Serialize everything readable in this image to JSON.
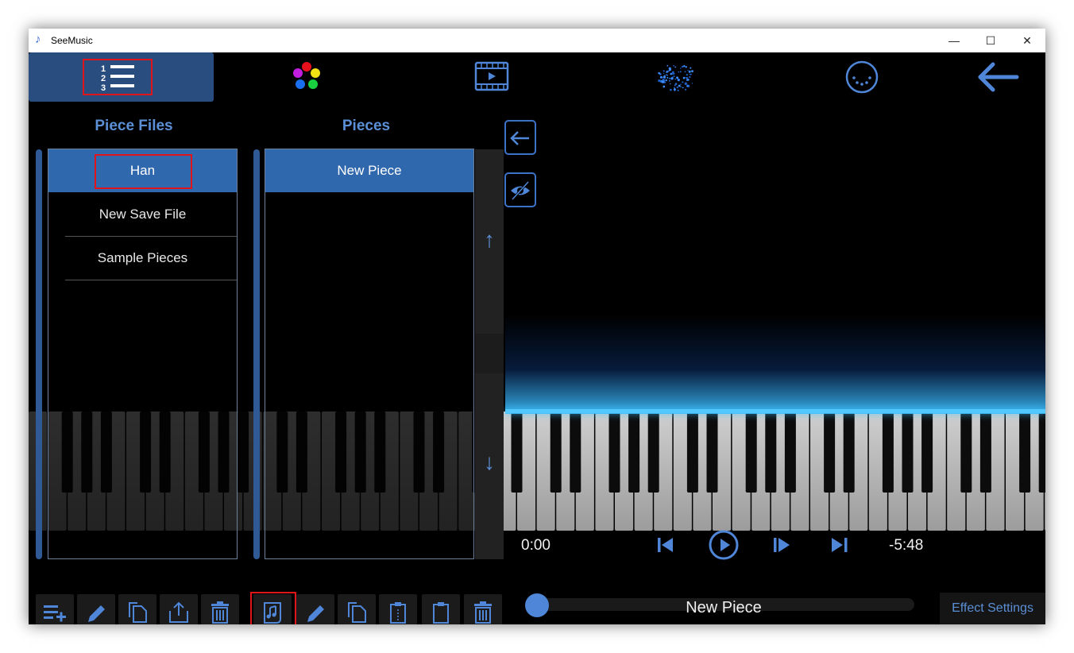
{
  "window": {
    "title": "SeeMusic",
    "min_symbol": "—",
    "max_symbol": "☐",
    "close_symbol": "✕"
  },
  "nav": {
    "items": [
      {
        "name": "playlist-icon",
        "active": true
      },
      {
        "name": "palette-icon",
        "active": false
      },
      {
        "name": "film-icon",
        "active": false
      },
      {
        "name": "particles-icon",
        "active": false
      },
      {
        "name": "midi-port-icon",
        "active": false
      },
      {
        "name": "back-arrow-icon",
        "active": false
      }
    ],
    "playlist_numbers": [
      "1",
      "2",
      "3"
    ]
  },
  "piece_files": {
    "title": "Piece Files",
    "items": [
      "Han",
      "New Save File",
      "Sample Pieces"
    ],
    "selected": "Han"
  },
  "pieces": {
    "title": "Pieces",
    "items": [
      "New Piece"
    ],
    "selected": "New Piece",
    "scroll_up": "↑",
    "scroll_down": "↓"
  },
  "left_toolbar": [
    "add-list-icon",
    "pencil-icon",
    "copy-icon",
    "export-icon",
    "trash-icon"
  ],
  "mid_toolbar": [
    "music-file-icon",
    "pencil-icon",
    "copy-icon",
    "paste-icon",
    "clipboard-icon",
    "trash-icon"
  ],
  "player": {
    "current_time": "0:00",
    "remaining_time": "-5:48",
    "piece_name": "New Piece",
    "progress": 0.0
  },
  "effect_settings_label": "Effect Settings",
  "colors": {
    "accent": "#3d73c7",
    "selected": "#3068ad",
    "title_blue": "#5b8fd6",
    "highlight": "#e0151b",
    "glow": "#29a9ff"
  }
}
